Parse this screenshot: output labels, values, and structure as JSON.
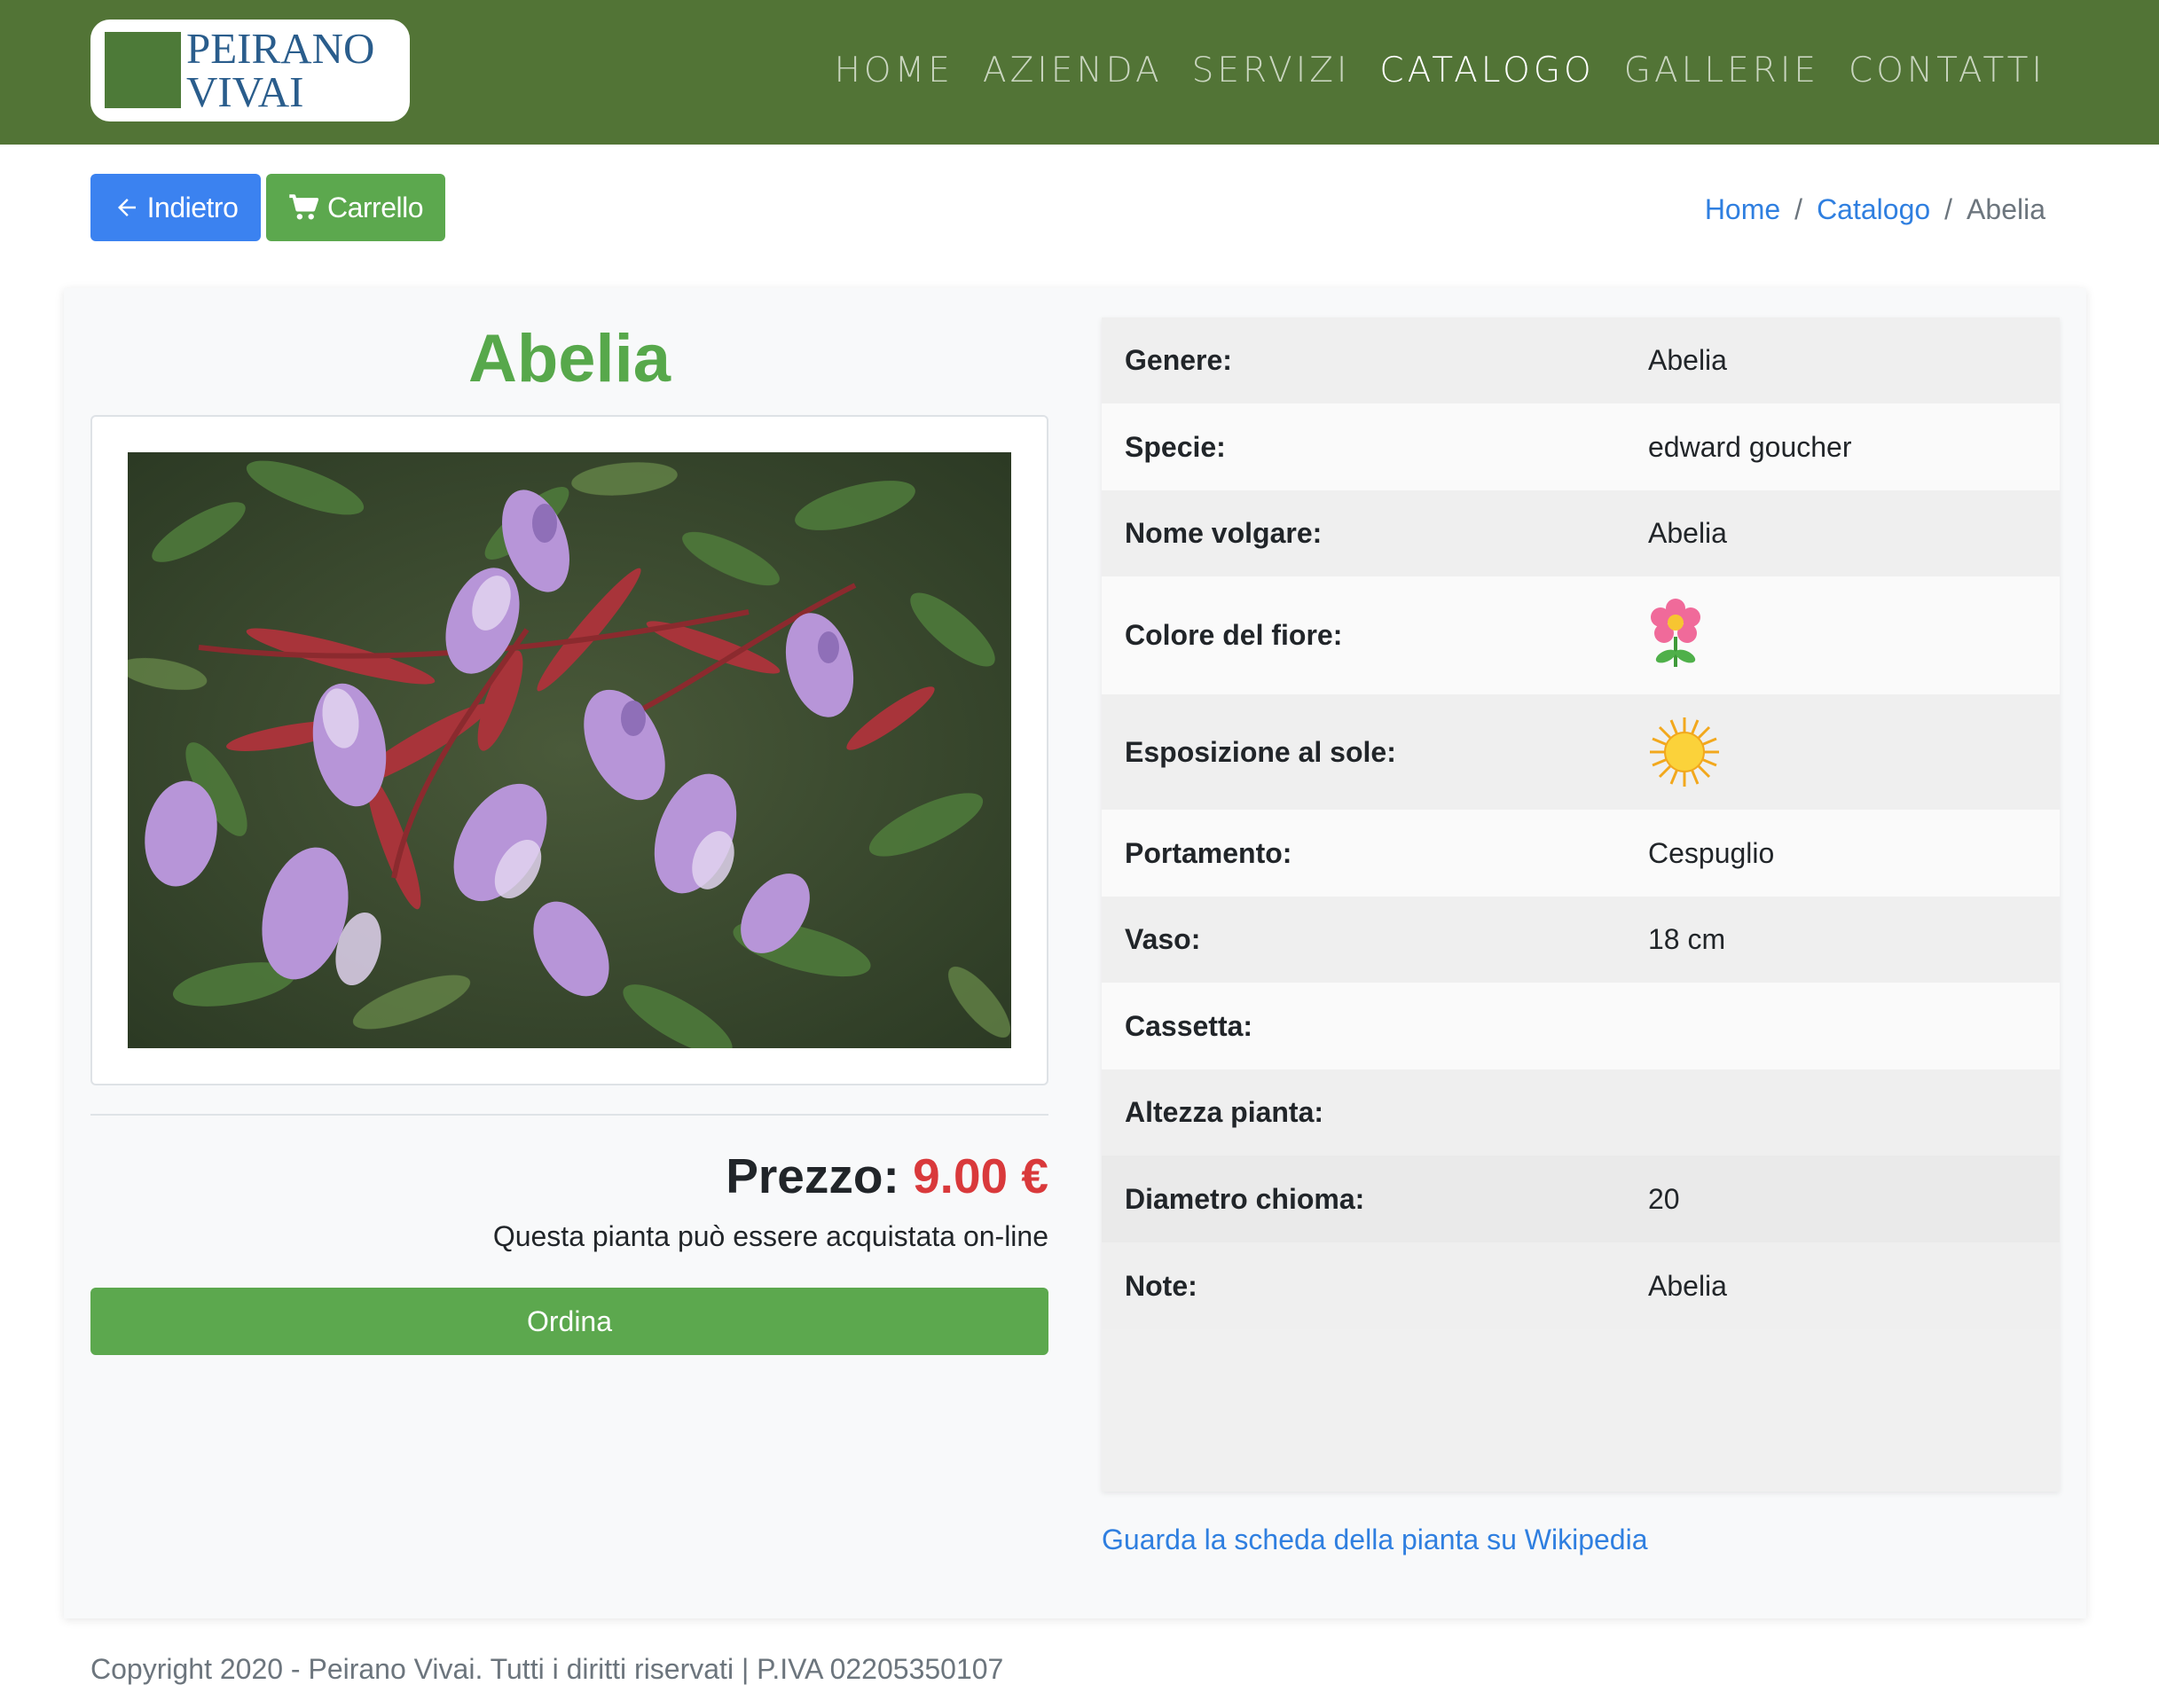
{
  "brand": {
    "line1": "PEIRANO",
    "line2": "VIVAI",
    "colors": {
      "header_bg": "#527436",
      "logo_square": "#4d7a38",
      "logo_text": "#2a5d8c"
    }
  },
  "nav": {
    "items": [
      {
        "label": "HOME",
        "active": false
      },
      {
        "label": "AZIENDA",
        "active": false
      },
      {
        "label": "SERVIZI",
        "active": false
      },
      {
        "label": "CATALOGO",
        "active": true
      },
      {
        "label": "GALLERIE",
        "active": false
      },
      {
        "label": "CONTATTI",
        "active": false
      }
    ]
  },
  "toolbar": {
    "back_label": "Indietro",
    "back_icon": "arrow-left-icon",
    "cart_label": "Carrello",
    "cart_icon": "shopping-cart-icon",
    "colors": {
      "back": "#3b82f0",
      "cart": "#5ca84e"
    }
  },
  "breadcrumb": {
    "items": [
      "Home",
      "Catalogo",
      "Abelia"
    ],
    "separator": "/"
  },
  "product": {
    "title": "Abelia",
    "price_label": "Prezzo:",
    "price_value": "9.00 €",
    "online_note": "Questa pianta può essere acquistata on-line",
    "order_label": "Ordina",
    "colors": {
      "title": "#57a84b",
      "price": "#d9393b"
    }
  },
  "specs": [
    {
      "label": "Genere:",
      "value": "Abelia"
    },
    {
      "label": "Specie:",
      "value": "edward goucher"
    },
    {
      "label": "Nome volgare:",
      "value": "Abelia"
    },
    {
      "label": "Colore del fiore:",
      "value": "",
      "icon": "pink-flower-icon"
    },
    {
      "label": "Esposizione al sole:",
      "value": "",
      "icon": "sun-icon"
    },
    {
      "label": "Portamento:",
      "value": "Cespuglio"
    },
    {
      "label": "Vaso:",
      "value": "18 cm"
    },
    {
      "label": "Cassetta:",
      "value": ""
    },
    {
      "label": "Altezza pianta:",
      "value": ""
    },
    {
      "label": "Diametro chioma:",
      "value": "20"
    },
    {
      "label": "Note:",
      "value": "Abelia"
    }
  ],
  "wiki_link": "Guarda la scheda della pianta su Wikipedia",
  "footer": "Copyright 2020 - Peirano Vivai. Tutti i diritti riservati | P.IVA 02205350107"
}
